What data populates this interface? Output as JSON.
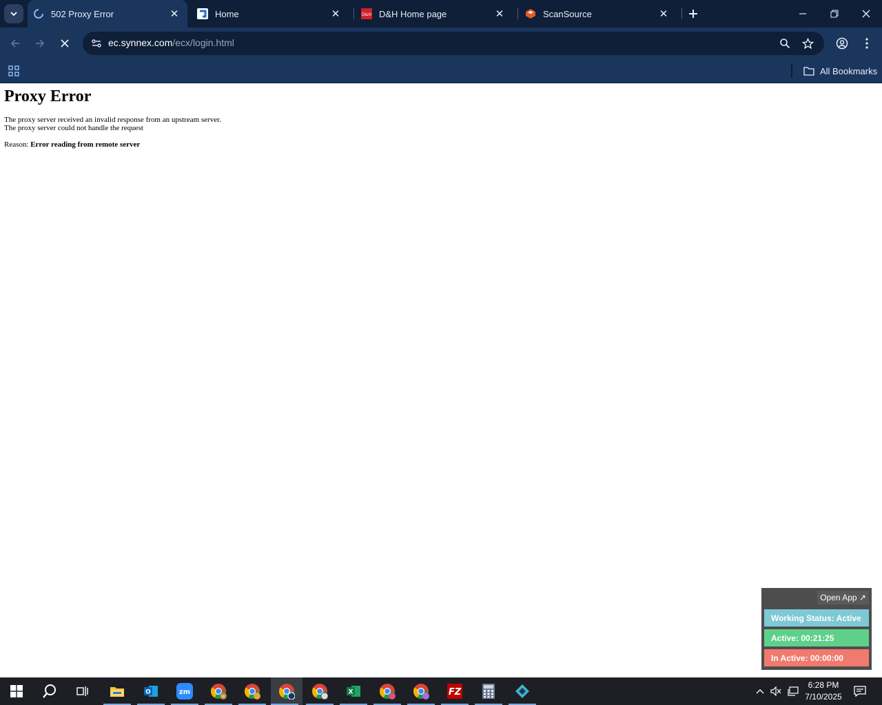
{
  "browser": {
    "tabs": [
      {
        "title": "502 Proxy Error",
        "favicon": "loading-spinner-icon",
        "active": true
      },
      {
        "title": "Home",
        "favicon": "home-favicon",
        "active": false
      },
      {
        "title": "D&H Home page",
        "favicon": "dh-favicon",
        "active": false
      },
      {
        "title": "ScanSource",
        "favicon": "scansource-favicon",
        "active": false
      }
    ],
    "address": {
      "domain": "ec.synnex.com",
      "path": "/ecx/login.html"
    },
    "bookmarks": {
      "all_label": "All Bookmarks"
    },
    "colors": {
      "frame": "#0f1f38",
      "toolbar": "#1b365d"
    }
  },
  "page": {
    "heading": "Proxy Error",
    "line1": "The proxy server received an invalid response from an upstream server.",
    "line2": "The proxy server could not handle the request",
    "reason_label": "Reason: ",
    "reason_value": "Error reading from remote server"
  },
  "widget": {
    "open_app_label": "Open App ↗",
    "working_status": "Working Status: Active",
    "active_time": "Active: 00:21:25",
    "inactive_time": "In Active: 00:00:00",
    "colors": {
      "status": "#7fc8d6",
      "active": "#5fd08a",
      "inactive": "#f07a6e"
    }
  },
  "taskbar": {
    "apps": [
      "start-icon",
      "search-icon",
      "task-view-icon",
      "file-explorer-icon",
      "outlook-icon",
      "zoom-icon",
      "chrome-icon",
      "chrome-icon",
      "chrome-icon",
      "chrome-icon",
      "excel-icon",
      "chrome-icon",
      "chrome-icon",
      "filezilla-icon",
      "calculator-icon",
      "app-icon"
    ],
    "time": "6:28 PM",
    "date": "7/10/2025"
  }
}
